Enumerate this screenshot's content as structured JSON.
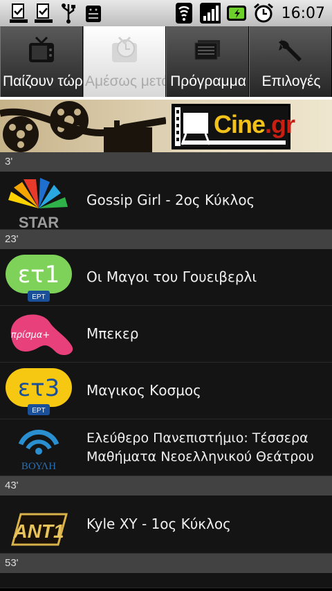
{
  "status_bar": {
    "left_icons": [
      "download-done-icon",
      "download-done-icon",
      "usb-icon",
      "android-debug-icon"
    ],
    "right_icons": [
      "wifi-icon",
      "signal-icon",
      "battery-charging-icon",
      "alarm-icon"
    ],
    "time": "16:07"
  },
  "tabs": [
    {
      "label": "Παίζουν τώρ",
      "icon": "tv-icon",
      "active": false
    },
    {
      "label": "Αμέσως μετά",
      "icon": "clock-tv-icon",
      "active": true
    },
    {
      "label": "Πρόγραμμα",
      "icon": "schedule-icon",
      "active": false
    },
    {
      "label": "Επιλογές",
      "icon": "wrench-icon",
      "active": false
    }
  ],
  "banner": {
    "logo_text_main": "Cine",
    "logo_text_suffix": ".gr"
  },
  "sections": [
    {
      "header": "3'",
      "items": [
        {
          "channel": "STAR",
          "title": "Gossip Girl - 2ος Κύκλος"
        }
      ]
    },
    {
      "header": "23'",
      "items": [
        {
          "channel": "ΕΤ1 ΕΡΤ",
          "title": "Οι Μαγοι του Γουειβερλι"
        },
        {
          "channel": "πρίσμα+",
          "title": "Μπεκερ"
        },
        {
          "channel": "ΕΤ3 ΕΡΤ",
          "title": "Μαγικος Κοσμος"
        },
        {
          "channel": "ΒΟΥΛΗ",
          "title": "Ελεύθερο Πανεπιστήμιο: Τέσσερα Μαθήματα Νεοελληνικού Θεάτρου"
        }
      ]
    },
    {
      "header": "43'",
      "items": [
        {
          "channel": "ANT1",
          "title": "Kyle XY - 1ος Κύκλος"
        }
      ]
    },
    {
      "header": "53'",
      "items": []
    }
  ],
  "logo_texts": {
    "star": "STAR",
    "ert": "ΕΡΤ",
    "prisma": "πρίσμα+",
    "vouli": "ΒΟΥΛΗ",
    "ant1": "ANT1"
  },
  "colors": {
    "et1_green": "#7ed25a",
    "et3_yellow": "#f7c812",
    "prisma_pink": "#e8407a",
    "ert_blue": "#1a4f9a"
  }
}
